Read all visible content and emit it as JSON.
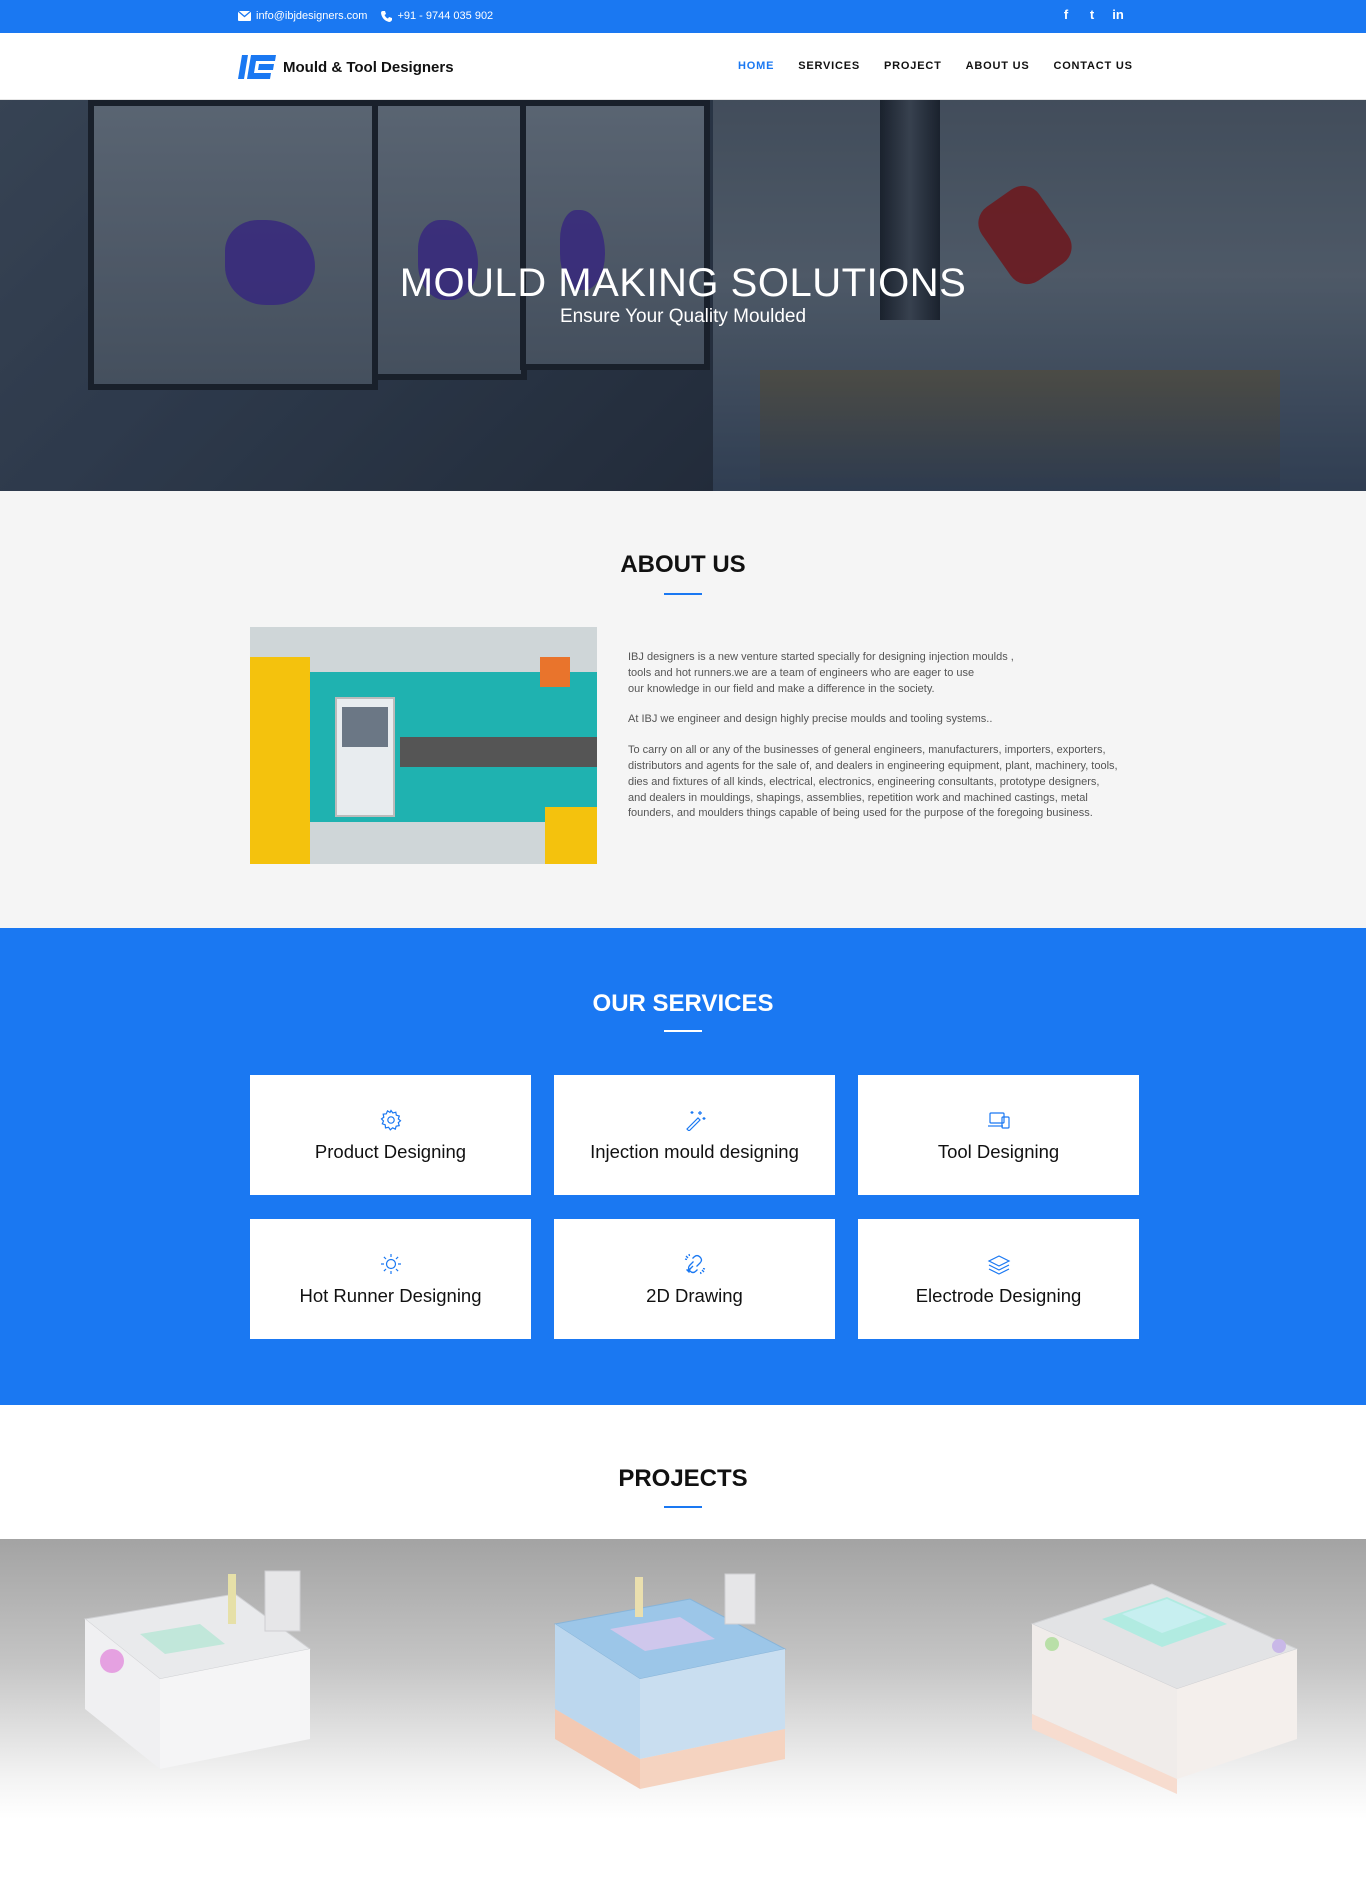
{
  "topbar": {
    "email": "info@ibjdesigners.com",
    "phone": "+91 - 9744 035 902",
    "social": [
      {
        "icon": "facebook-icon",
        "glyph": "f"
      },
      {
        "icon": "twitter-icon",
        "glyph": "t"
      },
      {
        "icon": "linkedin-icon",
        "glyph": "in"
      }
    ]
  },
  "brand": {
    "name": "Mould & Tool Designers",
    "color": "#1a78f2"
  },
  "nav": {
    "items": [
      {
        "label": "HOME",
        "active": true
      },
      {
        "label": "SERVICES",
        "active": false
      },
      {
        "label": "PROJECT",
        "active": false
      },
      {
        "label": "ABOUT US",
        "active": false
      },
      {
        "label": "CONTACT US",
        "active": false
      }
    ]
  },
  "hero": {
    "title": "MOULD MAKING SOLUTIONS",
    "subtitle": "Ensure Your Quality Moulded"
  },
  "about": {
    "title": "ABOUT US",
    "paragraphs": [
      "IBJ designers is a new venture started specially for designing injection moulds ,\ntools and hot runners.we are a team of engineers who are eager to use\nour knowledge in our field and make a difference in the society.",
      "At IBJ we engineer and design highly precise moulds and tooling systems..",
      "To carry on all or any of the businesses of general engineers, manufacturers, importers, exporters, distributors and agents for the sale of, and dealers in engineering equipment, plant, machinery, tools, dies and fixtures of all kinds, electrical, electronics, engineering consultants, prototype designers, and dealers in mouldings, shapings, assemblies, repetition work and machined castings, metal founders, and moulders things capable of being used for the purpose of the foregoing business."
    ]
  },
  "services": {
    "title": "OUR SERVICES",
    "items": [
      {
        "label": "Product Designing",
        "icon": "gear-icon"
      },
      {
        "label": "Injection mould designing",
        "icon": "magic-wand-icon"
      },
      {
        "label": "Tool Designing",
        "icon": "devices-icon"
      },
      {
        "label": "Hot Runner Designing",
        "icon": "sun-icon"
      },
      {
        "label": "2D Drawing",
        "icon": "link-icon"
      },
      {
        "label": "Electrode Designing",
        "icon": "layers-icon"
      }
    ]
  },
  "projects": {
    "title": "PROJECTS",
    "items": [
      {
        "name": "project-mould-1"
      },
      {
        "name": "project-mould-2"
      },
      {
        "name": "project-mould-3"
      }
    ]
  },
  "colors": {
    "accent": "#1a78f2",
    "about_bg": "#f5f5f5",
    "text_dark": "#111111"
  }
}
